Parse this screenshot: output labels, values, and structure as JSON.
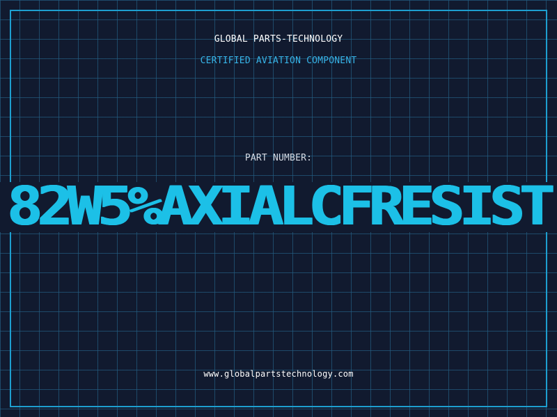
{
  "header": {
    "brand": "GLOBAL PARTS-TECHNOLOGY",
    "subtitle": "CERTIFIED AVIATION COMPONENT"
  },
  "part": {
    "label": "PART NUMBER:",
    "number": "82W5%AXIALCFRESIST"
  },
  "footer": {
    "website": "www.globalpartstechnology.com"
  },
  "colors": {
    "background": "#111a2f",
    "grid": "#235c80",
    "frame": "#1d9fd0",
    "accent": "#1cc0e7",
    "subtitle": "#37b4e8",
    "label": "#d5dbe4",
    "text": "#ffffff"
  }
}
